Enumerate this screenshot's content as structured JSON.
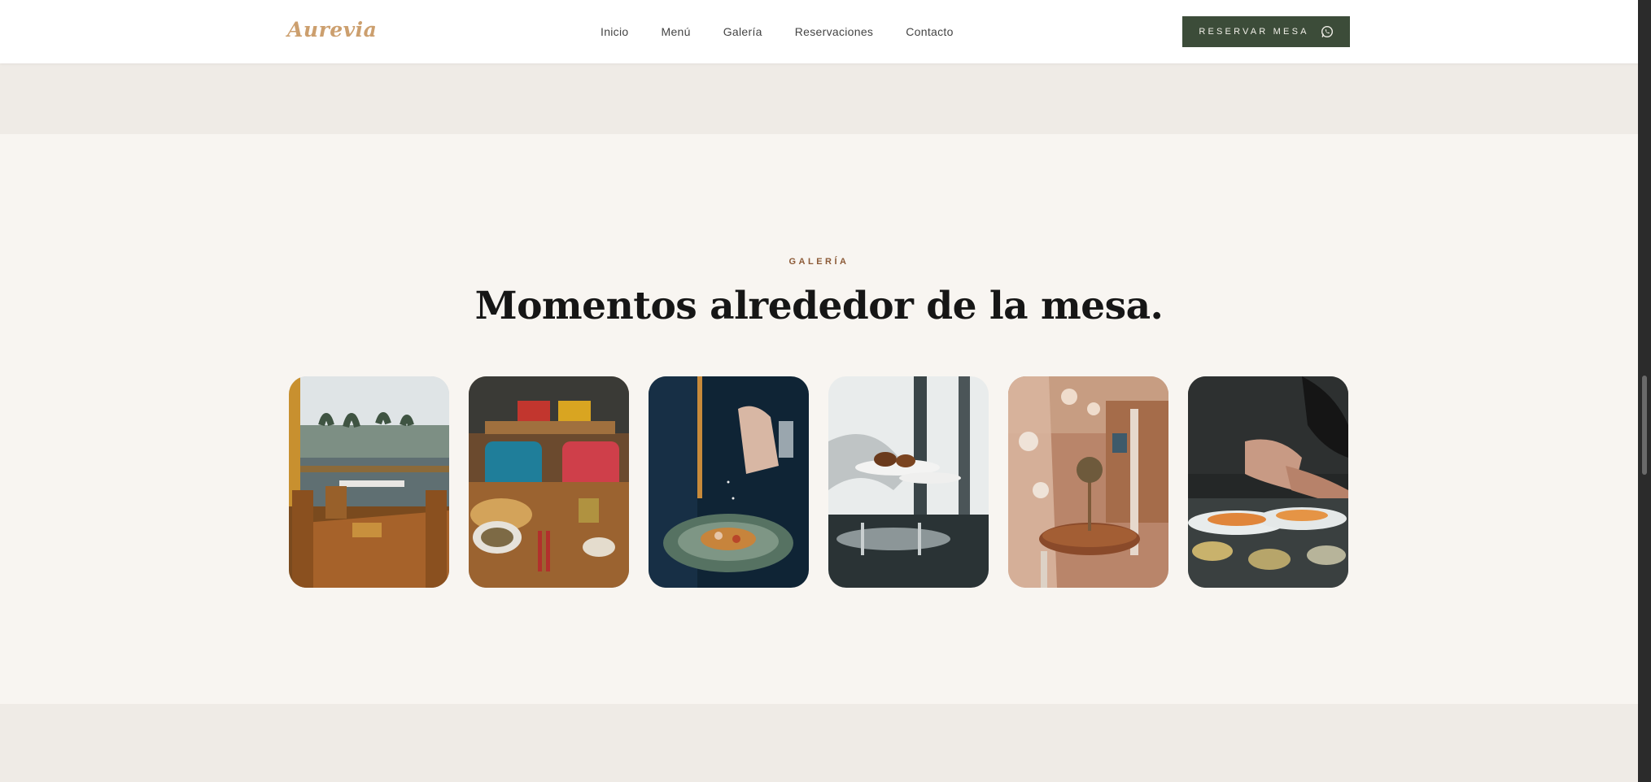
{
  "brand": {
    "name": "Aurevia",
    "accent": "#cc9f6e",
    "primary": "#3c4c39"
  },
  "nav": {
    "items": [
      {
        "label": "Inicio"
      },
      {
        "label": "Menú"
      },
      {
        "label": "Galería"
      },
      {
        "label": "Reservaciones"
      },
      {
        "label": "Contacto"
      }
    ]
  },
  "header": {
    "reserve_label": "RESERVAR MESA",
    "reserve_icon": "whatsapp-icon"
  },
  "gallery": {
    "eyebrow": "GALERÍA",
    "title": "Momentos alrededor de la mesa.",
    "photos": [
      {
        "name": "terrace-dining-photo"
      },
      {
        "name": "colorful-table-photo"
      },
      {
        "name": "chef-seasoning-photo"
      },
      {
        "name": "waiter-serving-photo"
      },
      {
        "name": "dining-room-photo"
      },
      {
        "name": "chef-plating-photo"
      }
    ]
  }
}
